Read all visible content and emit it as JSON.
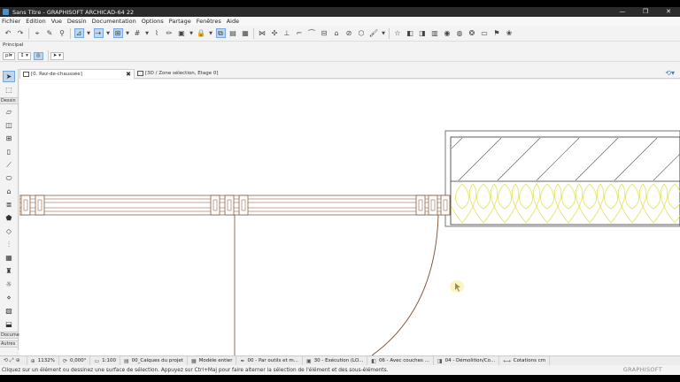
{
  "window": {
    "title": "Sans Titre - GRAPHISOFT ARCHICAD-64 22",
    "controls": [
      "—",
      "❐",
      "✕"
    ]
  },
  "menu": [
    "Fichier",
    "Edition",
    "Vue",
    "Dessin",
    "Documentation",
    "Options",
    "Partage",
    "Fenêtres",
    "Aide"
  ],
  "panel_label": "Principal",
  "toolbar2": {
    "floor_value": "pl▾",
    "arrow_value": "↕ ▾"
  },
  "tabs": [
    {
      "label": "[0. Rez-de-chaussée]",
      "active": true,
      "close": "✖"
    },
    {
      "label": "[3D / Zone sélection, Etage 0]",
      "active": false
    }
  ],
  "toolbox": {
    "section_dessin": "Dessin",
    "section_document": "Documen",
    "section_autres": "Autres"
  },
  "statusbar": {
    "zoom": "1132%",
    "angle": "0,000°",
    "scale": "1:100",
    "layers": "00_Calques du projet",
    "model": "Modèle entier",
    "pen_set": "00 - Par outils et m...",
    "model_view": "30 - Exécution (LO...",
    "override": "06 - Avec couches ...",
    "renovation": "04 - Démolition/Co...",
    "dimensions": "Cotations cm"
  },
  "hint": {
    "text": "Cliquez sur un élément ou dessinez une surface de sélection. Appuyez sur Ctrl+Maj pour faire alterner la sélection de l'élément et des sous-éléments.",
    "brand": "GRAPHISOFT"
  },
  "colors": {
    "wall_line": "#7a4a2a",
    "insulation": "#e3e35a",
    "selection": "#bcd7ef"
  }
}
